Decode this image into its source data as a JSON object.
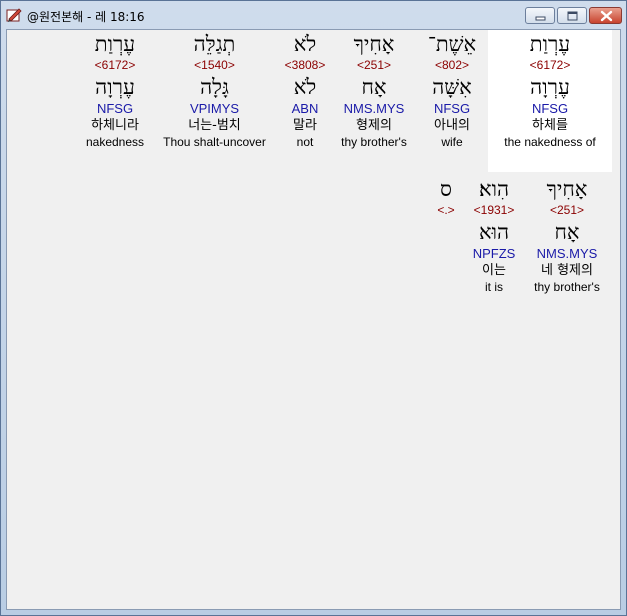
{
  "window": {
    "title": "@원전본해 - 레 18:16",
    "accent": "#c8432e"
  },
  "verse_line1": [
    {
      "hebrew": "עֶרְוַת",
      "strong": "<6172>",
      "lemma": "עֶרְוָה",
      "parse": "NFSG",
      "korean": "하체를",
      "english": "the nakedness of",
      "selected": true
    },
    {
      "hebrew": "אֵשֶׁת־",
      "strong": "<802>",
      "lemma": "אִשָּׁה",
      "parse": "NFSG",
      "korean": "아내의",
      "english": "wife"
    },
    {
      "hebrew": "אָחִיךָ",
      "strong": "<251>",
      "lemma": "אָח",
      "parse": "NMS.MYS",
      "korean": "형제의",
      "english": "thy brother's"
    },
    {
      "hebrew": "לֹא",
      "strong": "<3808>",
      "lemma": "לֹא",
      "parse": "ABN",
      "korean": "말라",
      "english": "not"
    },
    {
      "hebrew": "תְגַלֵּה",
      "strong": "<1540>",
      "lemma": "גָּלָה",
      "parse": "VPIMYS",
      "korean": "너는-범치",
      "english": "Thou shalt-uncover"
    },
    {
      "hebrew": "עֶרְוַת",
      "strong": "<6172>",
      "lemma": "עֶרְוָה",
      "parse": "NFSG",
      "korean": "하체니라",
      "english": "nakedness"
    }
  ],
  "verse_line2": [
    {
      "hebrew": "אָחִיךָ",
      "strong": "<251>",
      "lemma": "אָח",
      "parse": "NMS.MYS",
      "korean": "네 형제의",
      "english": "thy brother's"
    },
    {
      "hebrew": "הִוא׃",
      "strong": "<1931>",
      "lemma": "הוּא",
      "parse": "NPFZS",
      "korean": "이는",
      "english": "it is"
    },
    {
      "hebrew": "ס",
      "strong": "<.>",
      "lemma": "",
      "parse": "",
      "korean": "",
      "english": ""
    }
  ]
}
